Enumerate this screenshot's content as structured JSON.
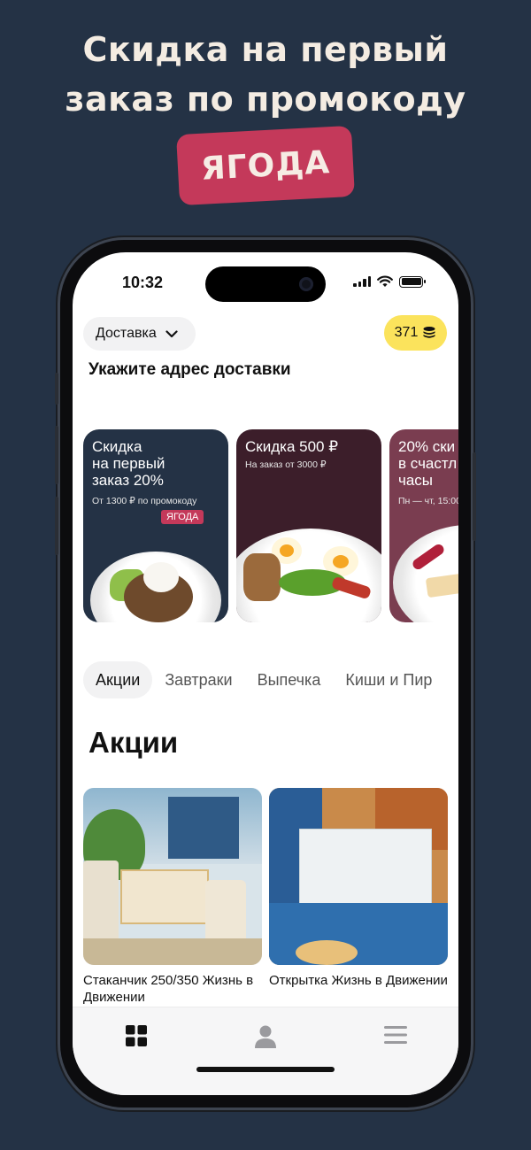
{
  "headline": {
    "line1": "Скидка на первый",
    "line2": "заказ по промокоду",
    "promo_code": "ЯГОДА"
  },
  "status_bar": {
    "time": "10:32"
  },
  "header": {
    "delivery_mode": "Доставка",
    "coins": "371",
    "address_prompt": "Укажите адрес доставки"
  },
  "banners": [
    {
      "title": "Скидка\nна первый\nзаказ 20%",
      "subtitle": "От 1300 ₽ по промокоду",
      "tag": "ЯГОДА"
    },
    {
      "title": "Скидка 500 ₽",
      "subtitle": "На заказ от 3000 ₽"
    },
    {
      "title": "20% ски\nв счастл\nчасы",
      "subtitle": "Пн — чт, 15:00"
    }
  ],
  "categories": [
    "Акции",
    "Завтраки",
    "Выпечка",
    "Киши и Пир"
  ],
  "section_title": "Акции",
  "products": [
    {
      "name": "Стаканчик 250/350 Жизнь в Движении"
    },
    {
      "name": "Открытка Жизнь в Движении"
    }
  ],
  "colors": {
    "background": "#243245",
    "promo": "#c4395a",
    "coins": "#fbe35c"
  },
  "tabbar": {
    "icons": [
      "menu-grid-icon",
      "profile-icon",
      "hamburger-menu-icon"
    ]
  }
}
